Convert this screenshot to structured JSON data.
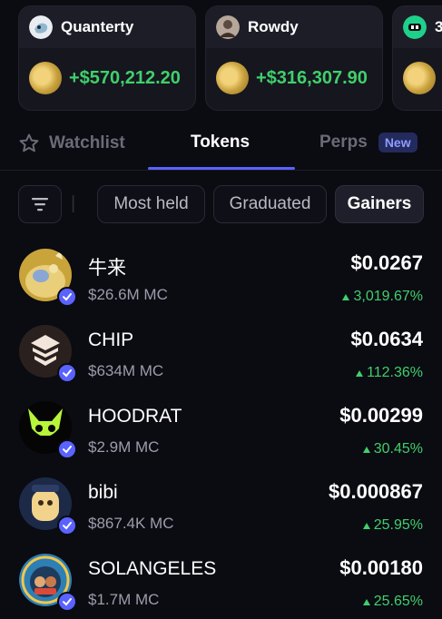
{
  "colors": {
    "background": "#0b0b12",
    "accent": "#5b63ff",
    "positive": "#3fd06b",
    "muted": "#9d9dab"
  },
  "top_traders": [
    {
      "name": "Quanterty",
      "pnl": "+$570,212.20"
    },
    {
      "name": "Rowdy",
      "pnl": "+$316,307.90"
    },
    {
      "name": "3"
    }
  ],
  "tabs": [
    {
      "label": "Watchlist",
      "icon": "star-icon",
      "active": false
    },
    {
      "label": "Tokens",
      "active": true
    },
    {
      "label": "Perps",
      "badge": "New",
      "active": false
    }
  ],
  "filters": {
    "icon": "filter-icon",
    "pills": [
      "Most held",
      "Graduated",
      "Gainers"
    ],
    "selected": "Gainers"
  },
  "tokens": [
    {
      "name": "牛来",
      "market_cap": "$26.6M MC",
      "price": "$0.0267",
      "change": "3,019.67%",
      "verified": true
    },
    {
      "name": "CHIP",
      "market_cap": "$634M MC",
      "price": "$0.0634",
      "change": "112.36%",
      "verified": true
    },
    {
      "name": "HOODRAT",
      "market_cap": "$2.9M MC",
      "price": "$0.00299",
      "change": "30.45%",
      "verified": true
    },
    {
      "name": "bibi",
      "market_cap": "$867.4K MC",
      "price": "$0.000867",
      "change": "25.95%",
      "verified": true
    },
    {
      "name": "SOLANGELES",
      "market_cap": "$1.7M MC",
      "price": "$0.00180",
      "change": "25.65%",
      "verified": true
    }
  ]
}
